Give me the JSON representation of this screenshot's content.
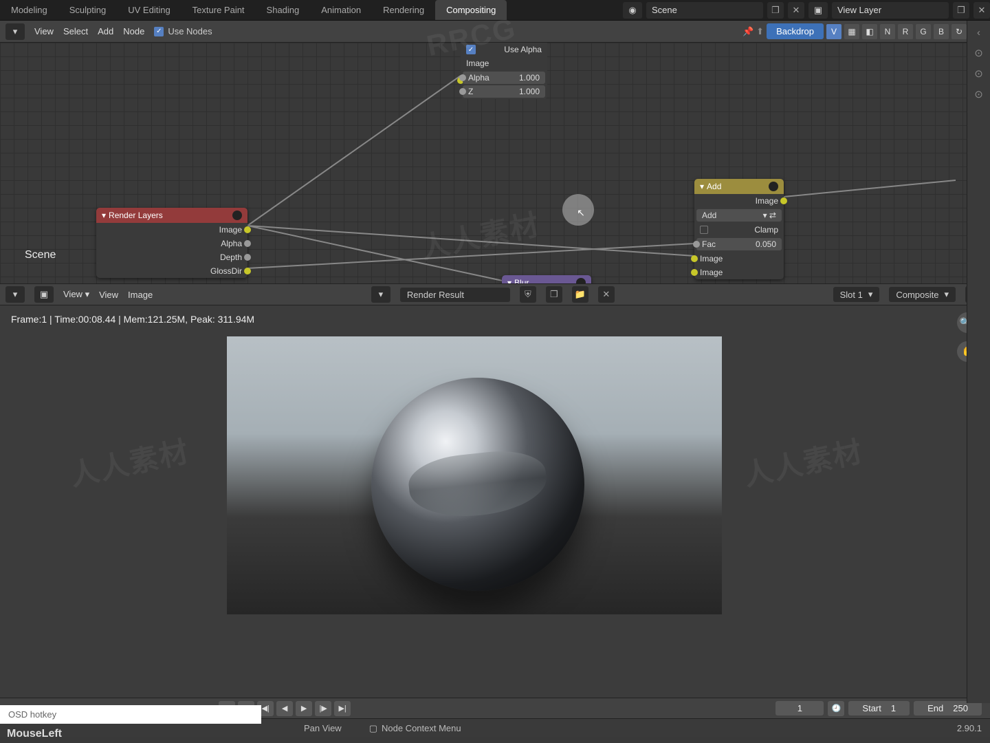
{
  "topbar": {
    "tabs": [
      "Modeling",
      "Sculpting",
      "UV Editing",
      "Texture Paint",
      "Shading",
      "Animation",
      "Rendering",
      "Compositing"
    ],
    "active_tab": "Compositing",
    "scene_label": "Scene",
    "viewlayer_label": "View Layer"
  },
  "node_header": {
    "menus": [
      "View",
      "Select",
      "Add",
      "Node"
    ],
    "use_nodes_label": "Use Nodes",
    "backdrop_label": "Backdrop",
    "channels": [
      "V",
      "N",
      "R",
      "G",
      "B"
    ]
  },
  "nodes": {
    "use_alpha": {
      "checkbox_label": "Use Alpha",
      "image_label": "Image",
      "alpha_label": "Alpha",
      "alpha_val": "1.000",
      "z_label": "Z",
      "z_val": "1.000"
    },
    "render_layers": {
      "title": "Render Layers",
      "outputs": [
        "Image",
        "Alpha",
        "Depth",
        "GlossDir"
      ],
      "scene_text": "Scene"
    },
    "add_node": {
      "title": "Add",
      "image_out": "Image",
      "mode": "Add",
      "clamp_label": "Clamp",
      "fac_label": "Fac",
      "fac_val": "0.050",
      "image1": "Image",
      "image2": "Image"
    },
    "blur_peek": "Blur"
  },
  "image_editor": {
    "menus": [
      "View",
      "View",
      "Image"
    ],
    "result_label": "Render Result",
    "slot_label": "Slot 1",
    "pass_label": "Composite",
    "stats_line": "Frame:1 | Time:00:08.44 | Mem:121.25M, Peak: 311.94M"
  },
  "timeline": {
    "current_frame": "1",
    "start_label": "Start",
    "start_val": "1",
    "end_label": "End",
    "end_val": "250"
  },
  "statusbar": {
    "mouse_event": "MouseLeft",
    "osd": "OSD hotkey",
    "pan": "Pan View",
    "context": "Node Context Menu",
    "version": "2.90.1"
  }
}
